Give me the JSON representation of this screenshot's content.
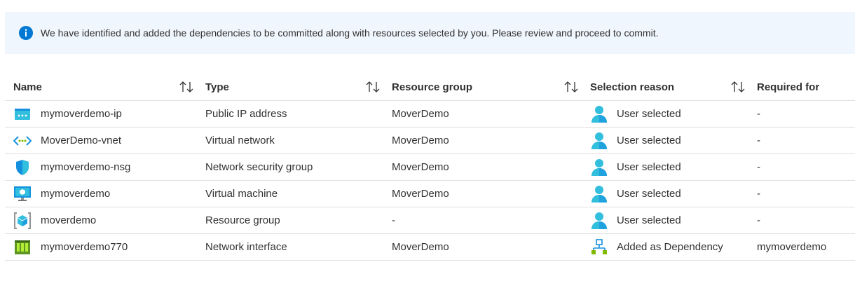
{
  "banner": {
    "icon": "info-icon",
    "message": "We have identified and added the dependencies to be committed along with resources selected by you. Please review and proceed to commit."
  },
  "colors": {
    "banner_bg": "#f0f6fe",
    "info_blue": "#0078d4",
    "divider": "#e1dfdd"
  },
  "table": {
    "headers": {
      "name": "Name",
      "type": "Type",
      "resource_group": "Resource group",
      "selection_reason": "Selection reason",
      "required_for": "Required for"
    },
    "rows": [
      {
        "name": "mymoverdemo-ip",
        "icon": "public-ip-icon",
        "type": "Public IP address",
        "resource_group": "MoverDemo",
        "reason_icon": "user-icon",
        "selection_reason": "User selected",
        "required_for": "-"
      },
      {
        "name": "MoverDemo-vnet",
        "icon": "virtual-network-icon",
        "type": "Virtual network",
        "resource_group": "MoverDemo",
        "reason_icon": "user-icon",
        "selection_reason": "User selected",
        "required_for": "-"
      },
      {
        "name": "mymoverdemo-nsg",
        "icon": "network-security-group-icon",
        "type": "Network security group",
        "resource_group": "MoverDemo",
        "reason_icon": "user-icon",
        "selection_reason": "User selected",
        "required_for": "-"
      },
      {
        "name": "mymoverdemo",
        "icon": "virtual-machine-icon",
        "type": "Virtual machine",
        "resource_group": "MoverDemo",
        "reason_icon": "user-icon",
        "selection_reason": "User selected",
        "required_for": "-"
      },
      {
        "name": "moverdemo",
        "icon": "resource-group-icon",
        "type": "Resource group",
        "resource_group": "-",
        "reason_icon": "user-icon",
        "selection_reason": "User selected",
        "required_for": "-"
      },
      {
        "name": "mymoverdemo770",
        "icon": "network-interface-icon",
        "type": "Network interface",
        "resource_group": "MoverDemo",
        "reason_icon": "dependency-icon",
        "selection_reason": "Added as Dependency",
        "required_for": "mymoverdemo"
      }
    ]
  }
}
